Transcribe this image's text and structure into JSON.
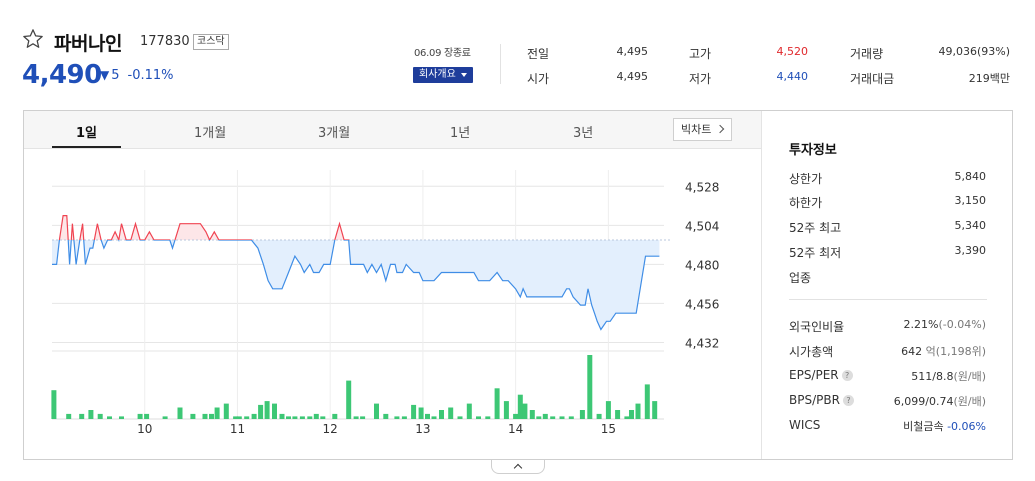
{
  "stock": {
    "name": "파버나인",
    "code": "177830",
    "market": "코스닥",
    "price": "4,490",
    "change": "5",
    "change_pct": "-0.11%"
  },
  "header": {
    "close_date": "06.09 장종료",
    "company_button": "회사개요"
  },
  "quote": {
    "prev_label": "전일",
    "prev_value": "4,495",
    "open_label": "시가",
    "open_value": "4,495",
    "high_label": "고가",
    "high_value": "4,520",
    "low_label": "저가",
    "low_value": "4,440",
    "volume_label": "거래량",
    "volume_value": "49,036(93%)",
    "amount_label": "거래대금",
    "amount_value": "219백만"
  },
  "tabs": [
    "1일",
    "1개월",
    "3개월",
    "1년",
    "3년"
  ],
  "big_chart_label": "빅차트",
  "colors": {
    "up": "#e0282c",
    "down": "#1f4fb8",
    "up_line": "#f04452",
    "down_line": "#3f8de6",
    "volume": "#3dc775"
  },
  "chart_data": {
    "type": "line",
    "base": 4495,
    "ylim": [
      4428,
      4538
    ],
    "yticks": [
      4528,
      4504,
      4480,
      4456,
      4432
    ],
    "ytick_labels": [
      "4,528",
      "4,504",
      "4,480",
      "4,456",
      "4,432"
    ],
    "x_labels": [
      "10",
      "11",
      "12",
      "13",
      "14",
      "15"
    ],
    "x_label_positions": [
      10,
      11,
      12,
      13,
      14,
      15
    ],
    "xlim": [
      9,
      15.6
    ],
    "x": [
      9.0,
      9.05,
      9.08,
      9.12,
      9.16,
      9.19,
      9.22,
      9.26,
      9.3,
      9.33,
      9.36,
      9.41,
      9.44,
      9.49,
      9.53,
      9.56,
      9.6,
      9.64,
      9.68,
      9.72,
      9.75,
      9.8,
      9.85,
      9.9,
      9.95,
      10.0,
      10.05,
      10.1,
      10.18,
      10.22,
      10.27,
      10.3,
      10.38,
      10.45,
      10.52,
      10.6,
      10.66,
      10.7,
      10.75,
      10.8,
      10.85,
      10.95,
      11.05,
      11.1,
      11.15,
      11.22,
      11.28,
      11.33,
      11.38,
      11.42,
      11.48,
      11.55,
      11.62,
      11.68,
      11.72,
      11.78,
      11.82,
      11.88,
      11.93,
      11.98,
      12.0,
      12.05,
      12.1,
      12.15,
      12.2,
      12.22,
      12.3,
      12.36,
      12.4,
      12.45,
      12.5,
      12.55,
      12.6,
      12.65,
      12.7,
      12.72,
      12.78,
      12.82,
      12.9,
      12.96,
      13.0,
      13.05,
      13.12,
      13.2,
      13.3,
      13.4,
      13.45,
      13.55,
      13.6,
      13.65,
      13.72,
      13.8,
      13.86,
      13.92,
      14.0,
      14.05,
      14.08,
      14.12,
      14.2,
      14.3,
      14.4,
      14.5,
      14.55,
      14.58,
      14.62,
      14.7,
      14.75,
      14.78,
      14.82,
      14.85,
      14.88,
      14.92,
      14.98,
      15.02,
      15.08,
      15.12,
      15.2,
      15.3,
      15.4,
      15.45,
      15.5,
      15.55
    ],
    "y": [
      4480,
      4480,
      4495,
      4510,
      4510,
      4480,
      4505,
      4480,
      4495,
      4505,
      4480,
      4490,
      4490,
      4505,
      4495,
      4490,
      4495,
      4495,
      4500,
      4495,
      4505,
      4495,
      4495,
      4505,
      4495,
      4495,
      4500,
      4495,
      4495,
      4495,
      4495,
      4490,
      4505,
      4505,
      4505,
      4505,
      4500,
      4495,
      4500,
      4495,
      4495,
      4495,
      4495,
      4495,
      4495,
      4490,
      4480,
      4470,
      4465,
      4465,
      4465,
      4475,
      4485,
      4480,
      4475,
      4480,
      4475,
      4475,
      4480,
      4480,
      4480,
      4495,
      4505,
      4495,
      4495,
      4480,
      4480,
      4480,
      4475,
      4480,
      4475,
      4480,
      4470,
      4480,
      4480,
      4475,
      4475,
      4480,
      4475,
      4475,
      4470,
      4470,
      4470,
      4475,
      4475,
      4475,
      4475,
      4475,
      4470,
      4470,
      4470,
      4475,
      4470,
      4470,
      4465,
      4460,
      4465,
      4460,
      4460,
      4460,
      4460,
      4460,
      4465,
      4465,
      4460,
      4455,
      4455,
      4465,
      4455,
      4450,
      4445,
      4440,
      4445,
      4445,
      4450,
      4450,
      4450,
      4450,
      4485,
      4485,
      4485,
      4485
    ],
    "volume_ylim": [
      0,
      100
    ],
    "volume_x": [
      9.02,
      9.18,
      9.32,
      9.42,
      9.52,
      9.62,
      9.75,
      9.95,
      10.02,
      10.22,
      10.38,
      10.52,
      10.65,
      10.72,
      10.78,
      10.88,
      10.98,
      11.02,
      11.1,
      11.18,
      11.25,
      11.32,
      11.4,
      11.48,
      11.55,
      11.62,
      11.7,
      11.78,
      11.85,
      11.92,
      12.05,
      12.2,
      12.28,
      12.35,
      12.5,
      12.6,
      12.72,
      12.8,
      12.9,
      12.98,
      13.05,
      13.12,
      13.2,
      13.3,
      13.4,
      13.5,
      13.6,
      13.7,
      13.8,
      13.9,
      14.0,
      14.05,
      14.1,
      14.18,
      14.25,
      14.32,
      14.4,
      14.5,
      14.6,
      14.72,
      14.8,
      14.9,
      15.0,
      15.1,
      15.2,
      15.25,
      15.32,
      15.42,
      15.5
    ],
    "volume": [
      45,
      8,
      8,
      14,
      8,
      4,
      4,
      8,
      8,
      4,
      18,
      8,
      8,
      8,
      18,
      24,
      4,
      4,
      4,
      8,
      22,
      28,
      24,
      8,
      4,
      4,
      4,
      4,
      8,
      4,
      8,
      60,
      4,
      4,
      24,
      8,
      4,
      4,
      22,
      18,
      8,
      4,
      14,
      18,
      4,
      24,
      4,
      4,
      48,
      28,
      8,
      38,
      24,
      14,
      4,
      8,
      4,
      4,
      4,
      14,
      100,
      8,
      28,
      14,
      4,
      14,
      24,
      54,
      28
    ]
  },
  "side": {
    "title": "투자정보",
    "upper_limit_label": "상한가",
    "upper_limit_value": "5,840",
    "lower_limit_label": "하한가",
    "lower_limit_value": "3,150",
    "high52_label": "52주 최고",
    "high52_value": "5,340",
    "low52_label": "52주 최저",
    "low52_value": "3,390",
    "sector_label": "업종",
    "foreign_label": "외국인비율",
    "foreign_value": "2.21%",
    "foreign_change": "(-0.04%)",
    "mcap_label": "시가총액",
    "mcap_value": "642",
    "mcap_unit": "억(1,198위)",
    "eps_label": "EPS/PER",
    "eps_value": "511/8.8",
    "eps_unit": "(원/배)",
    "bps_label": "BPS/PBR",
    "bps_value": "6,099/0.74",
    "bps_unit": "(원/배)",
    "wics_label": "WICS",
    "wics_value": "비철금속",
    "wics_change": "-0.06%"
  }
}
